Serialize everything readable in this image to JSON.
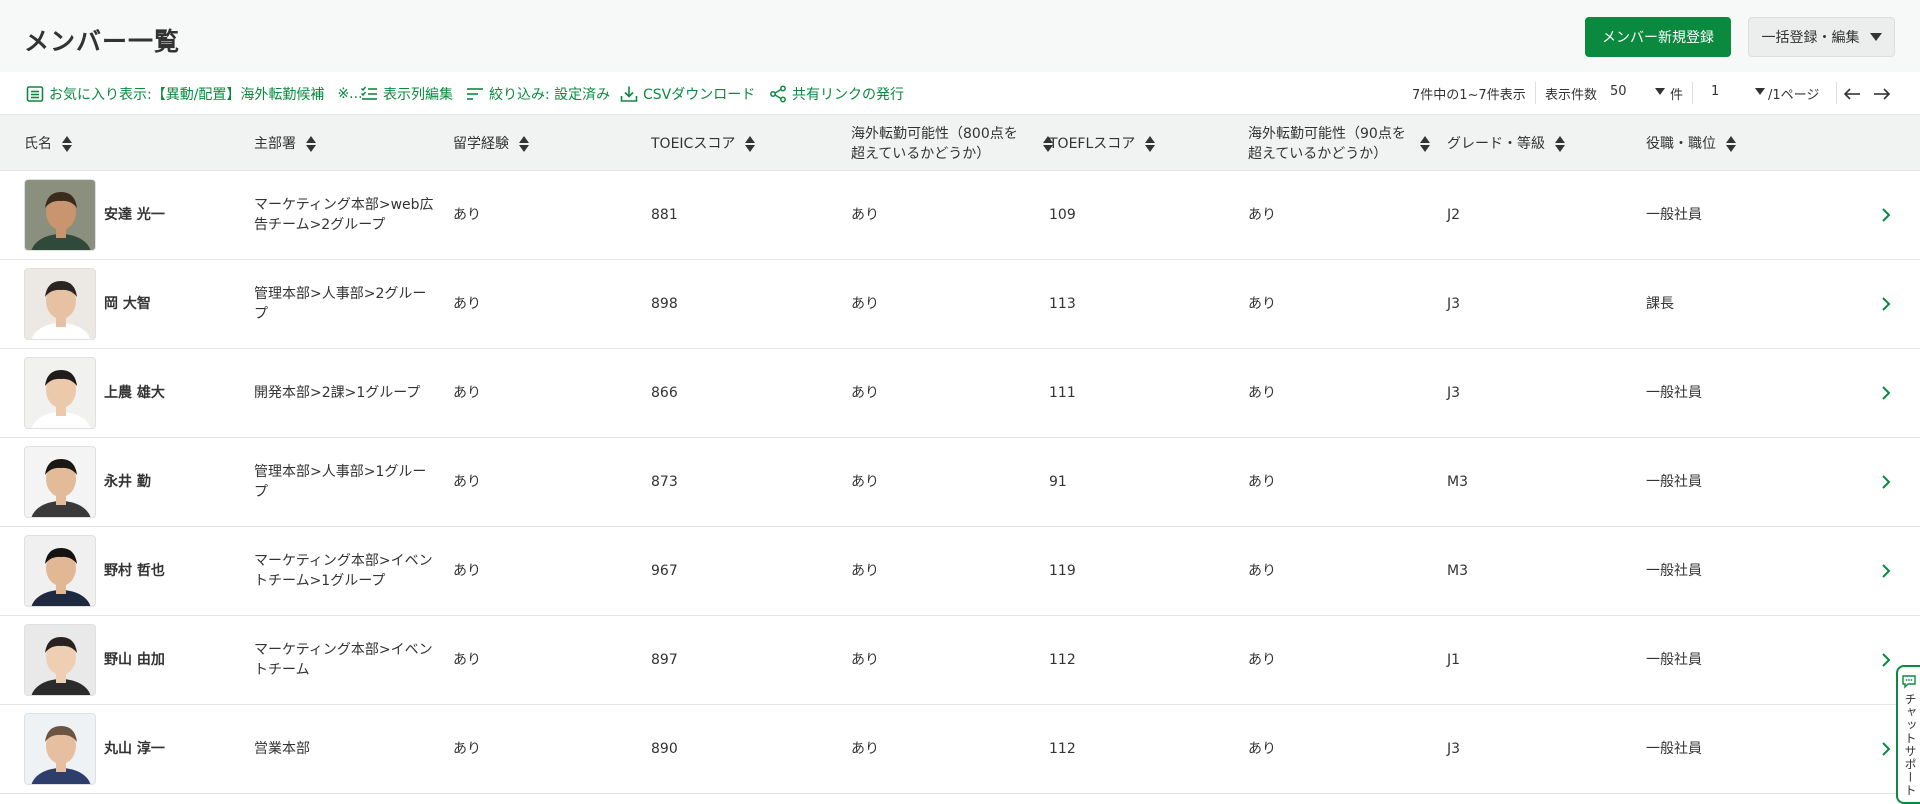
{
  "page": {
    "title": "メンバー一覧"
  },
  "header": {
    "new_member_button": "メンバー新規登録",
    "bulk_button": "一括登録・編集"
  },
  "toolbar": {
    "favorite_label": "お気に入り表示:【異動/配置】海外転勤候補",
    "favorite_more": "※...",
    "columns_label": "表示列編集",
    "filter_label": "絞り込み: 設定済み",
    "csv_label": "CSVダウンロード",
    "share_label": "共有リンクの発行"
  },
  "pager": {
    "summary": "7件中の1~7件表示",
    "per_page_label": "表示件数",
    "per_page_value": "50",
    "per_page_unit": "件",
    "page_value": "1",
    "page_total": "/1ページ"
  },
  "columns": {
    "name": "氏名",
    "department": "主部署",
    "study_abroad": "留学経験",
    "toeic": "TOEICスコア",
    "overseas_800": "海外転勤可能性（800点を超えているかどうか）",
    "toefl": "TOEFLスコア",
    "overseas_90": "海外転勤可能性（90点を超えているかどうか）",
    "grade": "グレード・等級",
    "position": "役職・職位"
  },
  "rows": [
    {
      "name": "安達 光一",
      "department": "マーケティング本部>web広告チーム>2グループ",
      "study_abroad": "あり",
      "toeic": "881",
      "overseas_800": "あり",
      "toefl": "109",
      "overseas_90": "あり",
      "grade": "J2",
      "position": "一般社員"
    },
    {
      "name": "岡 大智",
      "department": "管理本部>人事部>2グループ",
      "study_abroad": "あり",
      "toeic": "898",
      "overseas_800": "あり",
      "toefl": "113",
      "overseas_90": "あり",
      "grade": "J3",
      "position": "課長"
    },
    {
      "name": "上農 雄大",
      "department": "開発本部>2課>1グループ",
      "study_abroad": "あり",
      "toeic": "866",
      "overseas_800": "あり",
      "toefl": "111",
      "overseas_90": "あり",
      "grade": "J3",
      "position": "一般社員"
    },
    {
      "name": "永井 勤",
      "department": "管理本部>人事部>1グループ",
      "study_abroad": "あり",
      "toeic": "873",
      "overseas_800": "あり",
      "toefl": "91",
      "overseas_90": "あり",
      "grade": "M3",
      "position": "一般社員"
    },
    {
      "name": "野村 哲也",
      "department": "マーケティング本部>イベントチーム>1グループ",
      "study_abroad": "あり",
      "toeic": "967",
      "overseas_800": "あり",
      "toefl": "119",
      "overseas_90": "あり",
      "grade": "M3",
      "position": "一般社員"
    },
    {
      "name": "野山 由加",
      "department": "マーケティング本部>イベントチーム",
      "study_abroad": "あり",
      "toeic": "897",
      "overseas_800": "あり",
      "toefl": "112",
      "overseas_90": "あり",
      "grade": "J1",
      "position": "一般社員"
    },
    {
      "name": "丸山 淳一",
      "department": "営業本部",
      "study_abroad": "あり",
      "toeic": "890",
      "overseas_800": "あり",
      "toefl": "112",
      "overseas_90": "あり",
      "grade": "J3",
      "position": "一般社員"
    }
  ],
  "chat": {
    "label": "チャットサポート"
  },
  "icons": {
    "favorite": "list-icon",
    "columns": "checklist-icon",
    "filter": "filter-lines-icon",
    "csv": "download-icon",
    "share": "share-icon",
    "row_open": "chevron-right-icon",
    "prev": "arrow-left-icon",
    "next": "arrow-right-icon",
    "chat": "chat-bubble-icon"
  },
  "colors": {
    "accent": "#0b8a3f",
    "header_bg": "#f1f3f2",
    "text": "#333333"
  }
}
